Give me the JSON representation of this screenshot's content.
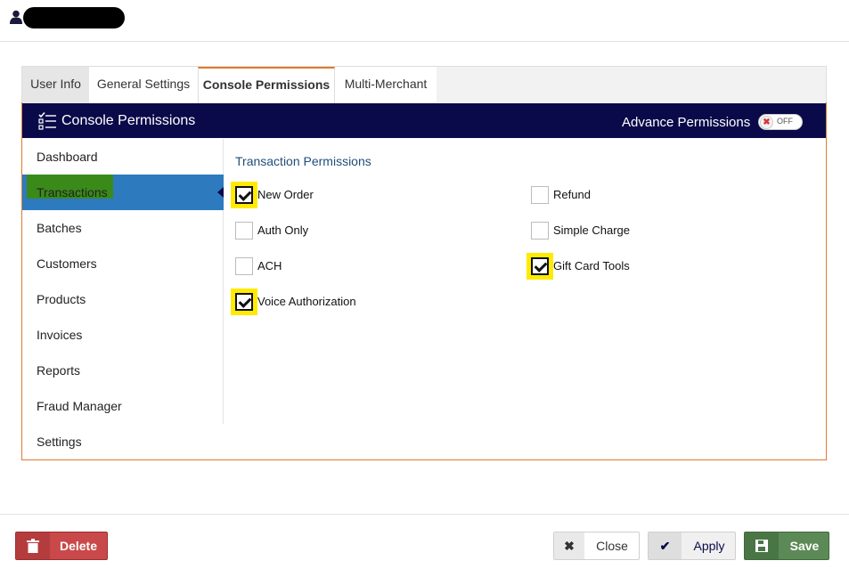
{
  "tabs": [
    {
      "label": "User Info"
    },
    {
      "label": "General Settings"
    },
    {
      "label": "Console Permissions"
    },
    {
      "label": "Multi-Merchant"
    }
  ],
  "header": {
    "title": "Console Permissions",
    "advance_label": "Advance Permissions",
    "toggle_label": "OFF",
    "toggle_icon": "x-icon"
  },
  "sidebar": {
    "items": [
      {
        "label": "Dashboard"
      },
      {
        "label": "Transactions",
        "active": true
      },
      {
        "label": "Batches"
      },
      {
        "label": "Customers"
      },
      {
        "label": "Products"
      },
      {
        "label": "Invoices"
      },
      {
        "label": "Reports"
      },
      {
        "label": "Fraud Manager"
      },
      {
        "label": "Settings"
      }
    ]
  },
  "permissions": {
    "title": "Transaction Permissions",
    "items": [
      {
        "label": "New Order",
        "checked": true
      },
      {
        "label": "Refund",
        "checked": false
      },
      {
        "label": "Auth Only",
        "checked": false
      },
      {
        "label": "Simple Charge",
        "checked": false
      },
      {
        "label": "ACH",
        "checked": false
      },
      {
        "label": "Gift Card Tools",
        "checked": true
      },
      {
        "label": "Voice Authorization",
        "checked": true
      }
    ]
  },
  "footer": {
    "delete_label": "Delete",
    "close_label": "Close",
    "apply_label": "Apply",
    "save_label": "Save"
  },
  "colors": {
    "accent": "#e07a2c",
    "header_bg": "#0a0a4a",
    "active_sidebar": "#2d7abf",
    "highlight": "#ffea00",
    "delete": "#c9494a",
    "save": "#5c8a57"
  }
}
